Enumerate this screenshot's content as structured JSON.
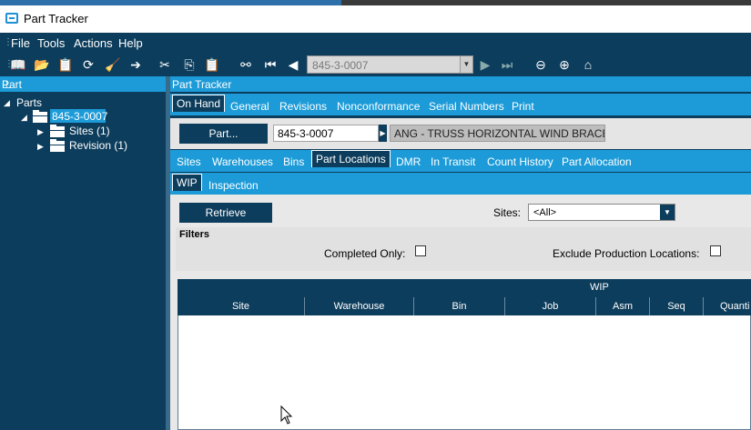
{
  "window": {
    "title": "Part Tracker"
  },
  "menu": {
    "items": [
      "File",
      "Tools",
      "Actions",
      "Help"
    ]
  },
  "toolbar": {
    "part_value": "845-3-0007"
  },
  "left_panel": {
    "header": "Part",
    "tree": {
      "root": "Parts",
      "part": "845-3-0007",
      "children": [
        "Sites (1)",
        "Revision (1)"
      ]
    }
  },
  "right_panel": {
    "header": "Part Tracker",
    "main_tabs": [
      "On Hand",
      "General",
      "Revisions",
      "Nonconformance",
      "Serial Numbers",
      "Print"
    ],
    "part_button": "Part...",
    "part_input": "845-3-0007",
    "part_description": "ANG - TRUSS HORIZONTAL WIND BRACE -",
    "sub_tabs": [
      "Sites",
      "Warehouses",
      "Bins",
      "Part Locations",
      "DMR",
      "In Transit",
      "Count History",
      "Part Allocation"
    ],
    "sub_sub_tabs": [
      "WIP",
      "Inspection"
    ],
    "retrieve_button": "Retrieve",
    "sites_label": "Sites:",
    "sites_value": "<All>",
    "filters_title": "Filters",
    "completed_only_label": "Completed Only:",
    "exclude_prod_label": "Exclude Production Locations:",
    "grid": {
      "title": "WIP",
      "columns": [
        "Site",
        "Warehouse",
        "Bin",
        "Job",
        "Asm",
        "Seq",
        "Quanti"
      ]
    }
  },
  "colors": {
    "dark_navy": "#0d3d5c",
    "accent_blue": "#1c9bd8"
  }
}
